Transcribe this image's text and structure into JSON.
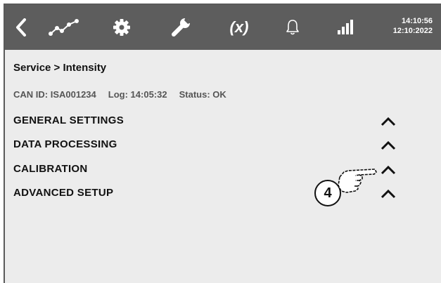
{
  "topbar": {
    "icons": [
      "back-icon",
      "trend-icon",
      "gear-icon",
      "wrench-icon",
      "function-icon",
      "bell-icon",
      "signal-icon"
    ],
    "fx_label": "(x)",
    "time": "14:10:56",
    "date": "12:10:2022",
    "background": "#5d5d5d"
  },
  "breadcrumb": "Service > Intensity",
  "status": {
    "can_id": "CAN ID: ISA001234",
    "log": "Log: 14:05:32",
    "status": "Status: OK"
  },
  "sections": [
    {
      "label": "GENERAL SETTINGS",
      "state_icon": "chevron-up-icon"
    },
    {
      "label": "DATA  PROCESSING",
      "state_icon": "chevron-up-icon"
    },
    {
      "label": "CALIBRATION",
      "state_icon": "chevron-up-icon"
    },
    {
      "label": "ADVANCED SETUP",
      "state_icon": "chevron-up-icon"
    }
  ],
  "callout": {
    "number": "4",
    "icon": "pointing-hand-icon"
  }
}
